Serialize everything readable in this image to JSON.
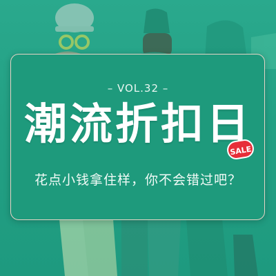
{
  "banner": {
    "volume": "– VOL.32 –",
    "title": "潮流折扣日",
    "sale_badge": "SALE",
    "subtitle": "花点小钱拿住样，你不会错过吧？"
  },
  "colors": {
    "background_teal": "#23a084",
    "panel_teal": "#1e9a7c",
    "panel_border": "#e7d6c7",
    "sale_red": "#e72e39",
    "text_white": "#ffffff"
  }
}
